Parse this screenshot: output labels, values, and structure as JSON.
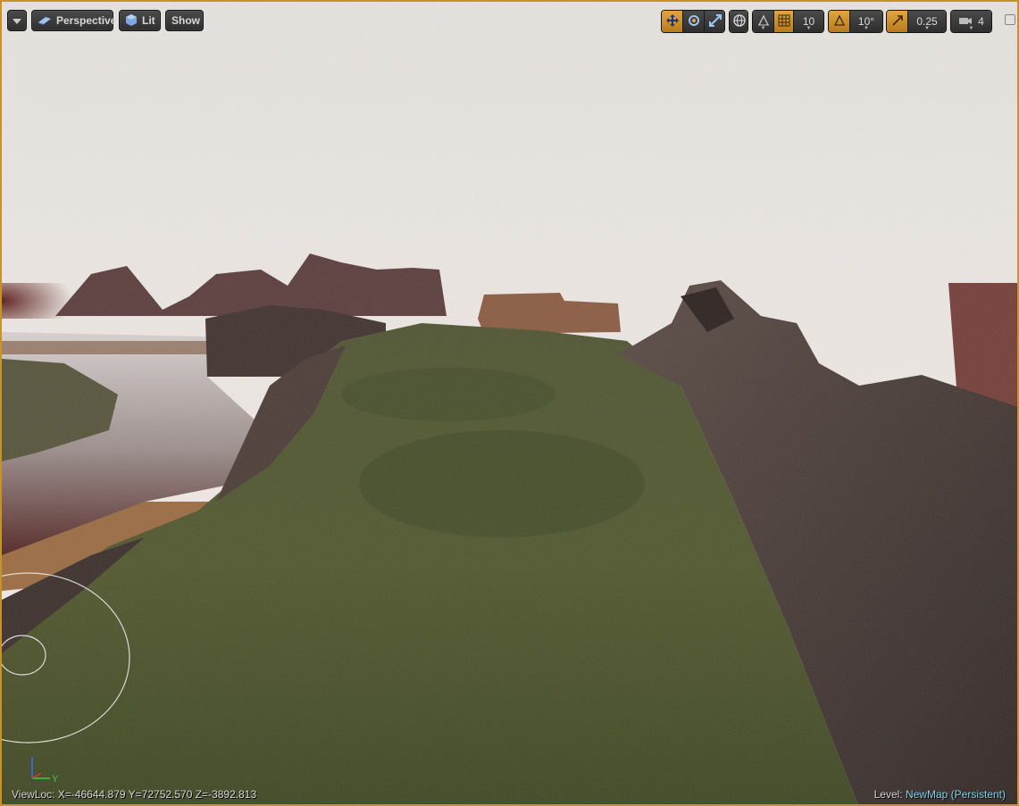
{
  "toolbar": {
    "menu_icon": "chevron-down-icon",
    "perspective_label": "Perspective",
    "lit_label": "Lit",
    "show_label": "Show",
    "grid_snap_value": "10",
    "rotation_snap_value": "10°",
    "scale_snap_value": "0.25",
    "camera_speed_value": "4"
  },
  "status": {
    "viewloc": "ViewLoc: X=-46644.879 Y=72752.570 Z=-3892.813",
    "level_label": "Level:",
    "level_name": "NewMap (Persistent)"
  },
  "axis": {
    "y_label": "Y"
  },
  "colors": {
    "accent": "#e0a640",
    "border": "#c8922a",
    "level_name": "#7fd3e6"
  }
}
